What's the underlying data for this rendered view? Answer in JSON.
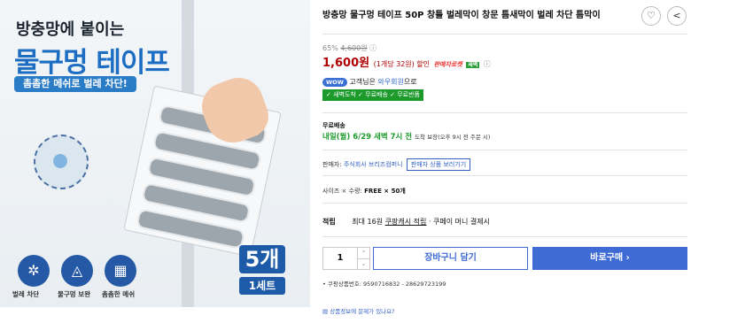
{
  "image": {
    "headline_top": "방충망에 붙이는",
    "headline_main": "물구멍 테이프",
    "subtitle": "촘촘한 메쉬로 벌레 차단!",
    "features": [
      {
        "icon": "bug-icon",
        "label": "벌레 차단"
      },
      {
        "icon": "water-drop-icon",
        "label": "물구멍 보완"
      },
      {
        "icon": "mesh-grid-icon",
        "label": "촘촘한 메쉬"
      }
    ],
    "count_badge": "5개",
    "set_badge": "1세트"
  },
  "product": {
    "title": "방충망 물구멍 테이프 50P 창틀 벌레막이 창문 틈새막이 벌레 차단 틈막이",
    "discount_rate": "65%",
    "original_price": "4,600원",
    "price": "1,600원",
    "unit_price": "(1개당 32원) 할인",
    "rocket_label": "판매자로켓",
    "new_badge": "새벽",
    "wow_badge": "WOW",
    "wow_text_1": "고객님은 ",
    "wow_member": "와우회원",
    "wow_text_2": "으로",
    "benefits": "✓ 새벽도착 ✓ 무료배송 ✓ 무료반품",
    "shipping_label": "무료배송",
    "shipping_eta": "내일(월) 6/29 새벽 7시 전",
    "shipping_note": "도착 보장(오후 9시 전 주문 시)",
    "seller_label": "판매자: ",
    "seller_name": "주식회사 브리즈컴퍼니",
    "seller_more": "판매자 상품 보러가기",
    "option_label": "사이즈 × 수량: ",
    "option_value": "FREE × 50개",
    "earn_label": "적립",
    "earn_text_1": "최대 16원 ",
    "earn_link": "쿠팡캐시 적립",
    "earn_text_2": " · 쿠페이 머니 결제시",
    "quantity": "1",
    "cart_button": "장바구니 담기",
    "buy_button": "바로구매 ›",
    "product_code": "• 쿠팡상품번호: 9590716832 - 28629723199",
    "report": "상품정보에 문제가 있나요?"
  },
  "colors": {
    "price": "#ae0000",
    "accent_blue": "#3f6bd5",
    "benefit_green": "#1d9a2c"
  }
}
